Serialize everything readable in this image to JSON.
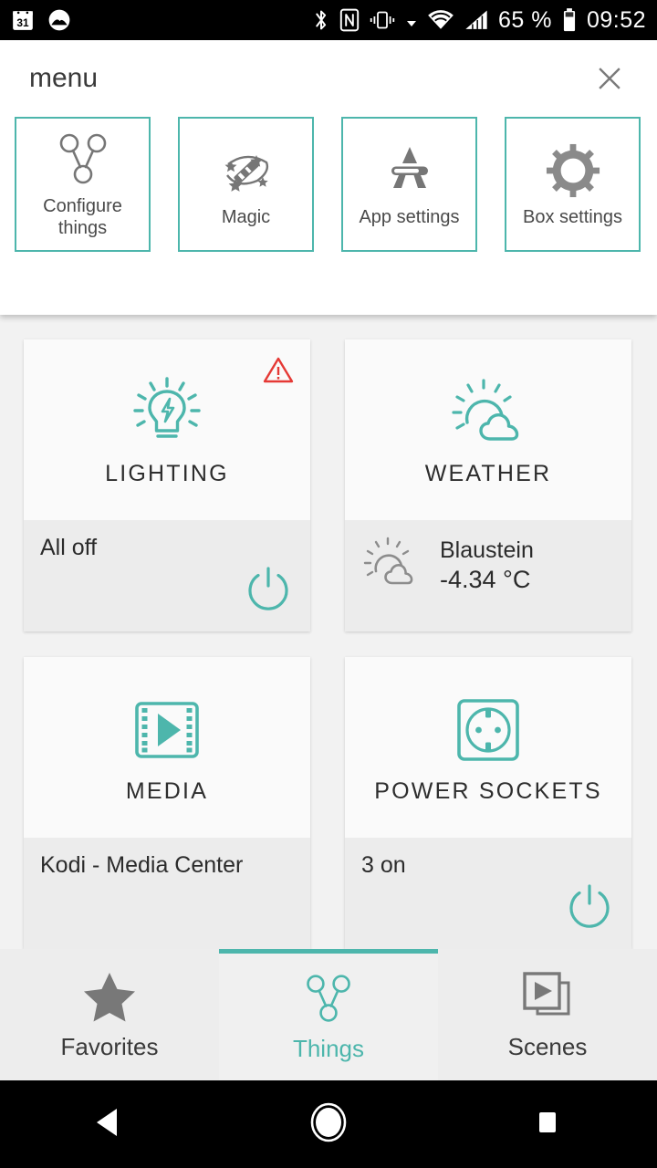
{
  "status_bar": {
    "left_icons": [
      "calendar-31-icon",
      "photos-cloud-icon"
    ],
    "calendar_day": "31",
    "right_icons": [
      "bluetooth-icon",
      "nfc-icon",
      "vibrate-icon",
      "dropdown-arrow-icon",
      "wifi-icon",
      "cellular-signal-icon"
    ],
    "battery_percent": "65 %",
    "battery_icon": "battery-icon",
    "clock": "09:52"
  },
  "menu": {
    "title": "menu",
    "close_icon": "close-icon",
    "cards": [
      {
        "label": "Configure things",
        "icon": "things-node-icon"
      },
      {
        "label": "Magic",
        "icon": "magic-wand-icon"
      },
      {
        "label": "App settings",
        "icon": "app-settings-icon"
      },
      {
        "label": "Box settings",
        "icon": "gear-icon"
      }
    ]
  },
  "tiles": [
    {
      "title": "LIGHTING",
      "icon": "lightbulb-icon",
      "status": "All off",
      "has_warning": true,
      "warning_icon": "warning-triangle-icon",
      "has_power": true,
      "power_icon": "power-icon"
    },
    {
      "title": "WEATHER",
      "icon": "sun-cloud-icon",
      "location": "Blaustein",
      "temperature": "-4.34 °C",
      "small_icon": "sun-cloud-small-icon",
      "has_warning": false,
      "has_power": false
    },
    {
      "title": "MEDIA",
      "icon": "film-play-icon",
      "status": "Kodi - Media Center",
      "has_warning": false,
      "has_power": false
    },
    {
      "title": "POWER SOCKETS",
      "icon": "power-socket-icon",
      "status": "3 on",
      "has_warning": false,
      "has_power": true,
      "power_icon": "power-icon"
    }
  ],
  "bottom_nav": [
    {
      "label": "Favorites",
      "icon": "star-icon",
      "active": false
    },
    {
      "label": "Things",
      "icon": "things-node-icon",
      "active": true
    },
    {
      "label": "Scenes",
      "icon": "scenes-stack-icon",
      "active": false
    }
  ],
  "android_nav": [
    {
      "name": "back-button",
      "icon": "back-triangle-icon"
    },
    {
      "name": "home-button",
      "icon": "home-circle-icon"
    },
    {
      "name": "recents-button",
      "icon": "recents-square-icon"
    }
  ],
  "colors": {
    "accent_teal": "#4db6ac",
    "warning_red": "#e53935",
    "icon_gray": "#767676",
    "tile_top_bg": "#fafafa",
    "tile_bottom_bg": "#ececec",
    "page_bg": "#f2f2f2"
  }
}
